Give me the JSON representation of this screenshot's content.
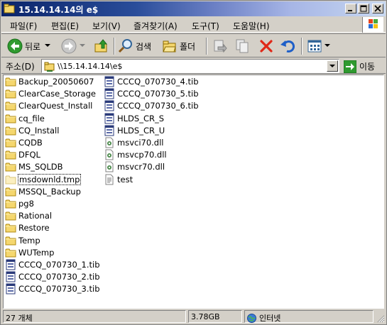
{
  "window": {
    "title": "15.14.14.14의 e$",
    "buttons": {
      "minimize": "minimize",
      "maximize": "maximize",
      "close": "close"
    }
  },
  "menu": [
    {
      "label": "파일(F)"
    },
    {
      "label": "편집(E)"
    },
    {
      "label": "보기(V)"
    },
    {
      "label": "즐겨찾기(A)"
    },
    {
      "label": "도구(T)"
    },
    {
      "label": "도움말(H)"
    }
  ],
  "toolbar": {
    "back_label": "뒤로",
    "search_label": "검색",
    "folders_label": "폴더"
  },
  "address": {
    "label": "주소(D)",
    "value": "\\\\15.14.14.14\\e$",
    "go_label": "이동"
  },
  "files_col1": [
    {
      "name": "Backup_20050607",
      "type": "folder"
    },
    {
      "name": "ClearCase_Storage",
      "type": "folder"
    },
    {
      "name": "ClearQuest_Install",
      "type": "folder"
    },
    {
      "name": "cq_file",
      "type": "folder"
    },
    {
      "name": "CQ_Install",
      "type": "folder"
    },
    {
      "name": "CQDB",
      "type": "folder"
    },
    {
      "name": "DFQL",
      "type": "folder"
    },
    {
      "name": "MS_SQLDB",
      "type": "folder"
    },
    {
      "name": "msdownld.tmp",
      "type": "folder-hidden"
    },
    {
      "name": "MSSQL_Backup",
      "type": "folder"
    },
    {
      "name": "pg8",
      "type": "folder"
    },
    {
      "name": "Rational",
      "type": "folder"
    },
    {
      "name": "Restore",
      "type": "folder"
    },
    {
      "name": "Temp",
      "type": "folder"
    },
    {
      "name": "WUTemp",
      "type": "folder"
    },
    {
      "name": "CCCQ_070730_1.tib",
      "type": "tib"
    },
    {
      "name": "CCCQ_070730_2.tib",
      "type": "tib"
    },
    {
      "name": "CCCQ_070730_3.tib",
      "type": "tib"
    }
  ],
  "files_col2": [
    {
      "name": "CCCQ_070730_4.tib",
      "type": "tib"
    },
    {
      "name": "CCCQ_070730_5.tib",
      "type": "tib"
    },
    {
      "name": "CCCQ_070730_6.tib",
      "type": "tib"
    },
    {
      "name": "HLDS_CR_S",
      "type": "tib"
    },
    {
      "name": "HLDS_CR_U",
      "type": "tib"
    },
    {
      "name": "msvci70.dll",
      "type": "dll"
    },
    {
      "name": "msvcp70.dll",
      "type": "dll"
    },
    {
      "name": "msvcr70.dll",
      "type": "dll"
    },
    {
      "name": "test",
      "type": "txt"
    }
  ],
  "status": {
    "count": "27 개체",
    "size": "3.78GB",
    "zone": "인터넷"
  },
  "colors": {
    "title_start": "#0a246a",
    "title_end": "#c8d8f0",
    "chrome": "#d4d0c8",
    "folder": "#f5d76e"
  }
}
